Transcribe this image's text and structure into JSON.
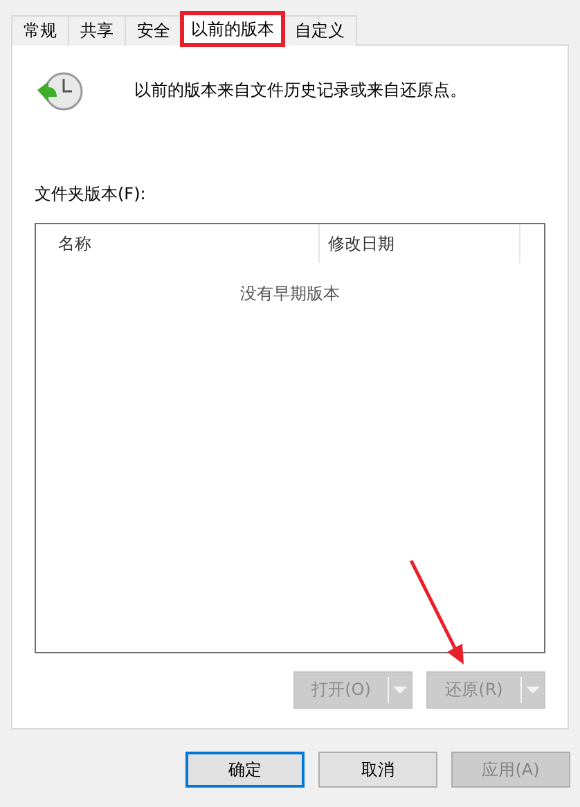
{
  "tabs": [
    {
      "label": "常规",
      "selected": false,
      "highlighted": false
    },
    {
      "label": "共享",
      "selected": false,
      "highlighted": false
    },
    {
      "label": "安全",
      "selected": false,
      "highlighted": false
    },
    {
      "label": "以前的版本",
      "selected": true,
      "highlighted": true
    },
    {
      "label": "自定义",
      "selected": false,
      "highlighted": false
    }
  ],
  "info_text": "以前的版本来自文件历史记录或来自还原点。",
  "list_label": "文件夹版本(F):",
  "list": {
    "columns": [
      "名称",
      "修改日期"
    ],
    "empty_text": "没有早期版本"
  },
  "list_buttons": [
    {
      "label": "打开(O)",
      "disabled": true
    },
    {
      "label": "还原(R)",
      "disabled": true
    }
  ],
  "annotation_arrow": true,
  "dialog_buttons": [
    {
      "label": "确定",
      "default": true,
      "disabled": false
    },
    {
      "label": "取消",
      "default": false,
      "disabled": false
    },
    {
      "label": "应用(A)",
      "default": false,
      "disabled": true
    }
  ]
}
